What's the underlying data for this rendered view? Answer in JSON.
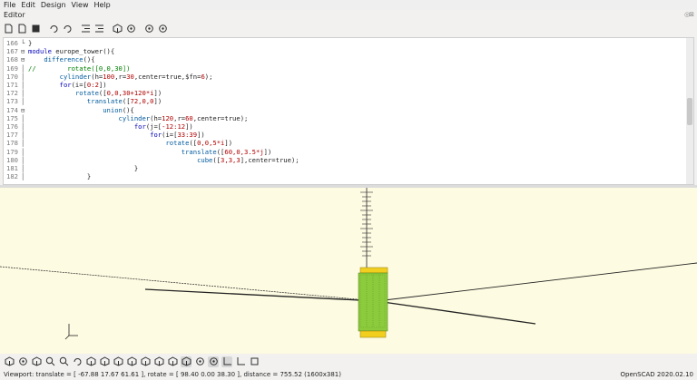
{
  "menu": [
    "File",
    "Edit",
    "Design",
    "View",
    "Help"
  ],
  "editor_title": "Editor",
  "editor_title_controls": "◎⊠",
  "toolbar_icons": [
    "new-file-icon",
    "open-file-icon",
    "save-icon",
    "undo-icon",
    "redo-icon",
    "indent-icon",
    "unindent-icon",
    "preview-icon",
    "render-icon",
    "send-to-print-icon",
    "export-stl-icon"
  ],
  "code_lines": [
    {
      "n": "166",
      "fold": "└",
      "parts": [
        [
          "",
          "}"
        ]
      ]
    },
    {
      "n": "167",
      "fold": "⊟",
      "parts": [
        [
          "kw",
          "module"
        ],
        [
          "",
          " europe_tower(){"
        ]
      ]
    },
    {
      "n": "168",
      "fold": "⊟",
      "parts": [
        [
          "",
          "    "
        ],
        [
          "fn",
          "difference"
        ],
        [
          "",
          "(){"
        ]
      ]
    },
    {
      "n": "169",
      "fold": "│",
      "parts": [
        [
          "cm",
          "//        rotate([0,0,30])"
        ]
      ]
    },
    {
      "n": "170",
      "fold": "│",
      "parts": [
        [
          "",
          "        "
        ],
        [
          "fn",
          "cylinder"
        ],
        [
          "",
          "(h="
        ],
        [
          "num",
          "100"
        ],
        [
          "",
          ",r="
        ],
        [
          "num",
          "30"
        ],
        [
          "",
          ",center=true,$fn="
        ],
        [
          "num",
          "6"
        ],
        [
          "",
          ");"
        ]
      ]
    },
    {
      "n": "171",
      "fold": "│",
      "parts": [
        [
          "",
          "        "
        ],
        [
          "kw",
          "for"
        ],
        [
          "",
          "(i=["
        ],
        [
          "num",
          "0:2"
        ],
        [
          "",
          "])"
        ]
      ]
    },
    {
      "n": "172",
      "fold": "│",
      "parts": [
        [
          "",
          "            "
        ],
        [
          "fn",
          "rotate"
        ],
        [
          "",
          "(["
        ],
        [
          "num",
          "0,0,30+120*i"
        ],
        [
          "",
          "])"
        ]
      ]
    },
    {
      "n": "173",
      "fold": "│",
      "parts": [
        [
          "",
          "               "
        ],
        [
          "fn",
          "translate"
        ],
        [
          "",
          "(["
        ],
        [
          "num",
          "72,0,0"
        ],
        [
          "",
          "])"
        ]
      ]
    },
    {
      "n": "174",
      "fold": "⊟",
      "parts": [
        [
          "",
          "                   "
        ],
        [
          "fn",
          "union"
        ],
        [
          "",
          "(){"
        ]
      ]
    },
    {
      "n": "175",
      "fold": "│",
      "parts": [
        [
          "",
          "                       "
        ],
        [
          "fn",
          "cylinder"
        ],
        [
          "",
          "(h="
        ],
        [
          "num",
          "120"
        ],
        [
          "",
          ",r="
        ],
        [
          "num",
          "60"
        ],
        [
          "",
          ",center=true);"
        ]
      ]
    },
    {
      "n": "176",
      "fold": "│",
      "parts": [
        [
          "",
          "                           "
        ],
        [
          "kw",
          "for"
        ],
        [
          "",
          "(j=["
        ],
        [
          "num",
          "-12:12"
        ],
        [
          "",
          "])"
        ]
      ]
    },
    {
      "n": "177",
      "fold": "│",
      "parts": [
        [
          "",
          "                               "
        ],
        [
          "kw",
          "for"
        ],
        [
          "",
          "(i=["
        ],
        [
          "num",
          "33:39"
        ],
        [
          "",
          "])"
        ]
      ]
    },
    {
      "n": "178",
      "fold": "│",
      "parts": [
        [
          "",
          "                                   "
        ],
        [
          "fn",
          "rotate"
        ],
        [
          "",
          "(["
        ],
        [
          "num",
          "0,0,5*i"
        ],
        [
          "",
          "])"
        ]
      ]
    },
    {
      "n": "179",
      "fold": "│",
      "parts": [
        [
          "",
          "                                       "
        ],
        [
          "fn",
          "translate"
        ],
        [
          "",
          "(["
        ],
        [
          "num",
          "60,0,3.5*j"
        ],
        [
          "",
          "])"
        ]
      ]
    },
    {
      "n": "180",
      "fold": "│",
      "parts": [
        [
          "",
          "                                           "
        ],
        [
          "fn",
          "cube"
        ],
        [
          "",
          "(["
        ],
        [
          "num",
          "3,3,3"
        ],
        [
          "",
          "],center=true);"
        ]
      ]
    },
    {
      "n": "181",
      "fold": "│",
      "parts": [
        [
          "",
          "                           }"
        ]
      ]
    },
    {
      "n": "182",
      "fold": "│",
      "parts": [
        [
          "",
          "               }"
        ]
      ]
    }
  ],
  "viewport_toolbar_icons": [
    "preview-icon",
    "render-icon",
    "view-all-icon",
    "zoom-in-icon",
    "zoom-out-icon",
    "reset-view-icon",
    "view-right-icon",
    "view-top-icon",
    "view-bottom-icon",
    "view-left-icon",
    "view-front-icon",
    "view-back-icon",
    "view-diagonal-icon",
    "view-center-icon",
    "perspective-icon",
    "orthogonal-icon",
    "show-axes-icon",
    "show-scale-icon",
    "show-edges-icon"
  ],
  "viewport_toolbar_active": [
    13,
    15,
    16
  ],
  "status": {
    "viewport": "Viewport: translate = [ -67.88 17.67 61.61 ], rotate = [ 98.40 0.00 38.30 ], distance = 755.52 (1600x381)",
    "version": "OpenSCAD 2020.02.10"
  },
  "colors": {
    "viewport_bg": "#fdfbe1",
    "model_green": "#8ccb3c",
    "model_yellow": "#f2cf1e",
    "keyword": "#0000b8",
    "number": "#b00000",
    "comment": "#008000"
  }
}
